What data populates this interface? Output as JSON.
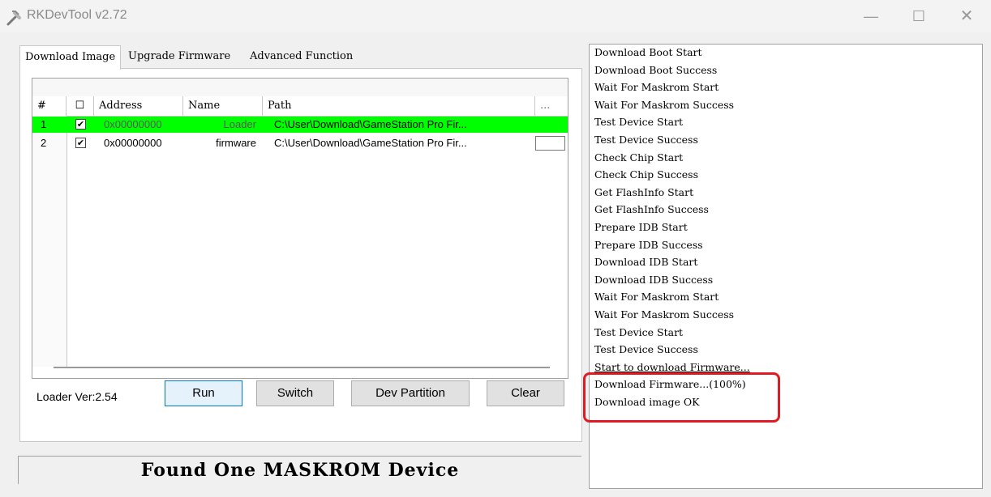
{
  "window": {
    "title": "RKDevTool v2.72"
  },
  "tabs": [
    "Download Image",
    "Upgrade Firmware",
    "Advanced Function"
  ],
  "table": {
    "headers": [
      "#",
      "☐",
      "Address",
      "Name",
      "Path",
      "..."
    ],
    "rows": [
      {
        "num": "1",
        "checked": "✔",
        "address": "0x00000000",
        "name": "Loader",
        "path": "C:\\User\\Download\\GameStation Pro Fir..."
      },
      {
        "num": "2",
        "checked": "✔",
        "address": "0x00000000",
        "name": "firmware",
        "path": "C:\\User\\Download\\GameStation Pro Fir..."
      }
    ]
  },
  "loader_ver": "Loader Ver:2.54",
  "buttons": {
    "run": "Run",
    "switch": "Switch",
    "dev_partition": "Dev Partition",
    "clear": "Clear"
  },
  "status": "Found One MASKROM Device",
  "log": [
    "Download Boot Start",
    "Download Boot Success",
    "Wait For Maskrom Start",
    "Wait For Maskrom Success",
    "Test Device Start",
    "Test Device Success",
    "Check Chip Start",
    " Check Chip Success",
    "Get FlashInfo Start",
    "Get FlashInfo Success",
    "Prepare IDB Start",
    "Prepare IDB Success",
    "Download IDB Start",
    "Download IDB Success",
    "Wait For Maskrom Start",
    "Wait For Maskrom Success",
    "Test Device Start",
    "Test Device Success",
    "Start to download Firmware...",
    "Download Firmware...(100%)",
    "Download image OK"
  ],
  "colors": {
    "selected_row": "#00ff00",
    "highlight": "#e21b22"
  },
  "icons": {
    "app": "rk-tool-icon",
    "minimize": "minimize-icon",
    "maximize": "maximize-icon",
    "close": "close-icon"
  }
}
